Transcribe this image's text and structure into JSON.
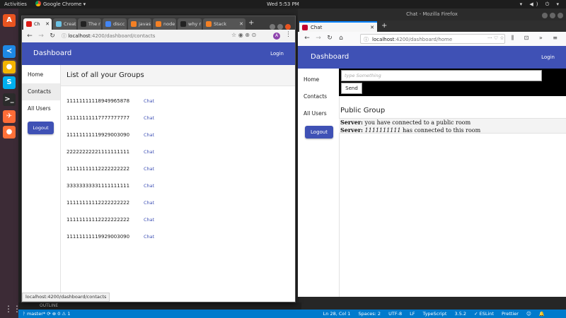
{
  "topbar": {
    "activities": "Activities",
    "app_name": "Google Chrome ▾",
    "clock": "Wed  5:53 PM",
    "tray": "▾ ◀) ⏻ ▾"
  },
  "launcher": {
    "items": [
      {
        "icon": "software-center-icon",
        "glyph": "A",
        "color": "#e95420"
      },
      {
        "icon": "vscode-icon",
        "glyph": "≺",
        "color": "#1e88e5"
      },
      {
        "icon": "chrome-icon",
        "glyph": "●",
        "color": "#f4b400"
      },
      {
        "icon": "skype-icon",
        "glyph": "S",
        "color": "#00aff0"
      },
      {
        "icon": "terminal-icon",
        "glyph": ">_",
        "color": "#2b2b2b"
      },
      {
        "icon": "postman-icon",
        "glyph": "✈",
        "color": "#ff6c37"
      },
      {
        "icon": "firefox-icon",
        "glyph": "●",
        "color": "#ff7139"
      }
    ],
    "apps_grid": "⋮⋮⋮"
  },
  "editor": {
    "outline_label": "OUTLINE",
    "status_left": "ᚹ master*  ⟳  ⊗ 0 ⚠ 1",
    "status_right": [
      "Ln 28, Col 1",
      "Spaces: 2",
      "UTF-8",
      "LF",
      "TypeScript",
      "3.5.2",
      "✓ ESLint",
      "Prettier",
      "☺",
      "🔔"
    ]
  },
  "chrome": {
    "tabs": [
      {
        "label": "Ch",
        "active": true,
        "color": "#dd1b16"
      },
      {
        "label": "Creat",
        "active": false,
        "color": "#6bc2e5"
      },
      {
        "label": "The r",
        "active": false,
        "color": "#222222"
      },
      {
        "label": "discc",
        "active": false,
        "color": "#4285f4"
      },
      {
        "label": "javas",
        "active": false,
        "color": "#f48024"
      },
      {
        "label": "node",
        "active": false,
        "color": "#f48024"
      },
      {
        "label": "why r",
        "active": false,
        "color": "#222222"
      },
      {
        "label": "Stack",
        "active": false,
        "color": "#f48024"
      }
    ],
    "url_host": "localhost",
    "url_path": ":4200/dashboard/contacts",
    "avatar_letter": "A",
    "status_url": "localhost:4200/dashboard/contacts"
  },
  "chrome_app": {
    "title": "Dashboard",
    "login": "Login",
    "nav": [
      "Home",
      "Contacts",
      "All Users"
    ],
    "logout": "Logout",
    "heading": "List of all your Groups",
    "chat_label": "Chat",
    "groups": [
      "11111111118949965878",
      "11111111117777777777",
      "11111111119929003090",
      "22222222221111111111",
      "11111111112222222222",
      "33333333331111111111",
      "11111111112222222222",
      "11111111112222222222",
      "11111111119929003090"
    ]
  },
  "firefox": {
    "window_title": "Chat - Mozilla Firefox",
    "tab_label": "Chat",
    "url_host": "localhost",
    "url_path": ":4200/dashboard/home",
    "right_icons": "⫼ ⊡ » ≡"
  },
  "firefox_app": {
    "title": "Dashboard",
    "login": "Login",
    "nav": [
      "Home",
      "Contacts",
      "All Users"
    ],
    "logout": "Logout",
    "input_placeholder": "type Something",
    "send": "Send",
    "group_title": "Public Group",
    "messages": [
      {
        "sender": "Server:",
        "text": " you have connected to a public room"
      },
      {
        "sender": "Server:",
        "italic": "1111111111",
        "text": " has connected to this room"
      }
    ]
  }
}
